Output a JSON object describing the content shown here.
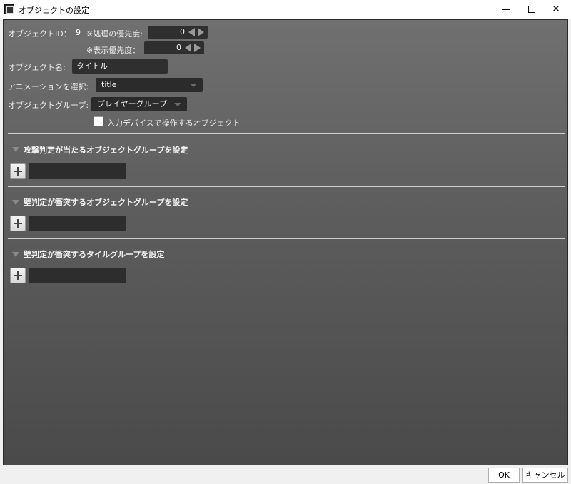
{
  "window": {
    "title": "オブジェクトの設定",
    "icon": "film-icon"
  },
  "form": {
    "object_id_label": "オブジェクトID：",
    "object_id_value": "9",
    "process_priority_label": "※処理の優先度:",
    "process_priority_value": "0",
    "display_priority_label": "※表示優先度：",
    "display_priority_value": "0",
    "object_name_label": "オブジェクト名:",
    "object_name_value": "タイトル",
    "animation_label": "アニメーションを選択:",
    "animation_value": "title",
    "group_label": "オブジェクトグループ:",
    "group_value": "プレイヤーグループ",
    "input_device_label": "入力デバイスで操作するオブジェクト",
    "input_device_checked": false
  },
  "sections": [
    {
      "title": "攻撃判定が当たるオブジェクトグループを設定"
    },
    {
      "title": "壁判定が衝突するオブジェクトグループを設定"
    },
    {
      "title": "壁判定が衝突するタイルグループを設定"
    }
  ],
  "footer": {
    "ok_label": "OK",
    "cancel_label": "キャンセル"
  }
}
